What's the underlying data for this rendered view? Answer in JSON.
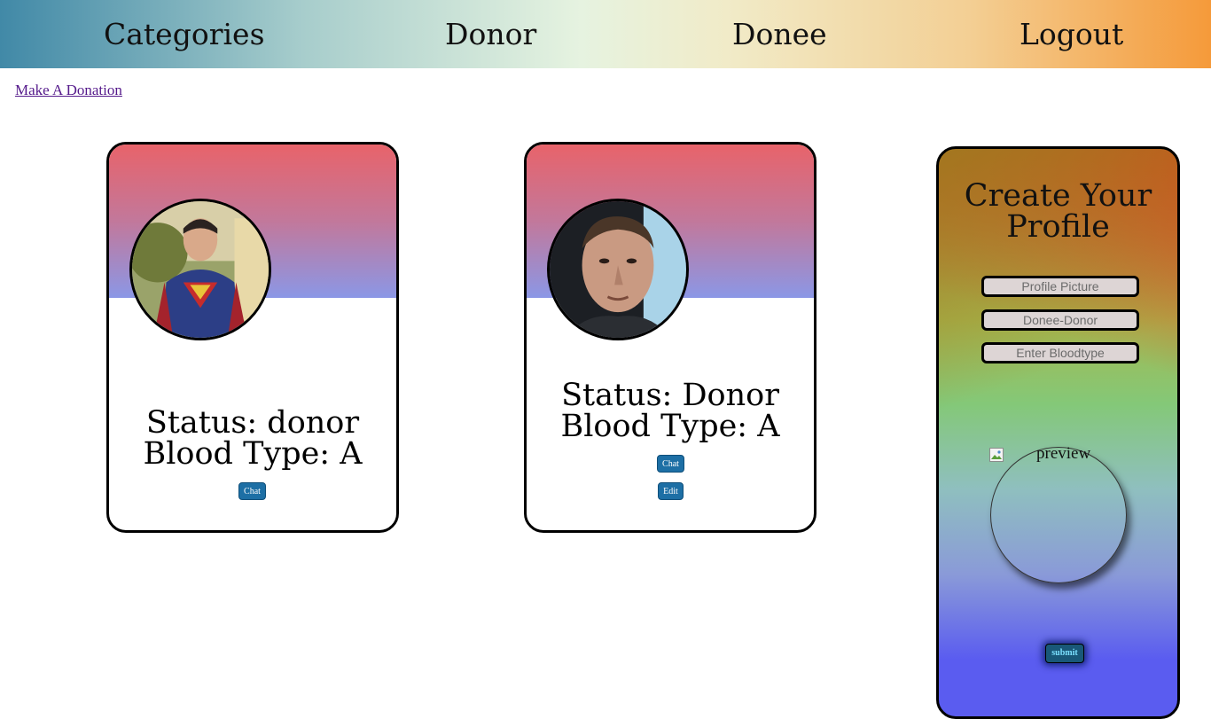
{
  "nav": {
    "categories": "Categories",
    "donor": "Donor",
    "donee": "Donee",
    "logout": "Logout"
  },
  "make_donation": "Make A Donation",
  "cards": [
    {
      "status": "Status: donor",
      "blood_type": "Blood Type: A",
      "chat_label": "Chat"
    },
    {
      "status": "Status: Donor",
      "blood_type": "Blood Type: A",
      "chat_label": "Chat",
      "edit_label": "Edit"
    }
  ],
  "profile_form": {
    "title_line1": "Create Your",
    "title_line2": "Profile",
    "profile_picture_placeholder": "Profile Picture",
    "donee_donor_placeholder": "Donee-Donor",
    "bloodtype_placeholder": "Enter Bloodtype",
    "preview_alt": "preview",
    "submit_label": "submit"
  },
  "colors": {
    "button": "#1d6fa5",
    "card_header_top": "#e8636a",
    "card_header_bottom": "#8b97e6"
  }
}
